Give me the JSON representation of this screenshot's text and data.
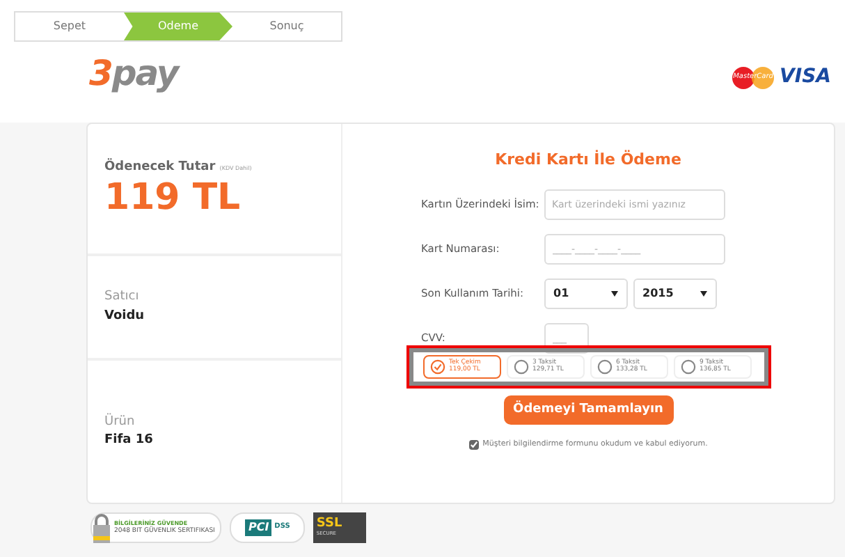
{
  "steps": [
    {
      "label": "Sepet",
      "selected": false
    },
    {
      "label": "Odeme",
      "selected": true
    },
    {
      "label": "Sonuç",
      "selected": false
    }
  ],
  "logo": {
    "digit": "3",
    "word": "pay"
  },
  "card_brands": {
    "mastercard": "MasterCard",
    "visa": "VISA"
  },
  "summary": {
    "amount_label": "Ödenecek Tutar",
    "amount_note": "(KDV Dahil)",
    "amount": "119 TL",
    "seller_label": "Satıcı",
    "seller": "Voidu",
    "product_label": "Ürün",
    "product": "Fifa 16"
  },
  "form": {
    "title": "Kredi Kartı İle Ödeme",
    "name_label": "Kartın Üzerindeki İsim:",
    "name_placeholder": "Kart üzerindeki ismi yazınız",
    "number_label": "Kart Numarası:",
    "number_placeholder": "____-____-____-____",
    "expiry_label": "Son Kullanım Tarihi:",
    "month": "01",
    "year": "2015",
    "cvv_label": "CVV:",
    "cvv_placeholder": "___",
    "installments": [
      {
        "label": "Tek Çekim",
        "amount": "119,00 TL",
        "selected": true
      },
      {
        "label": "3 Taksit",
        "amount": "129,71 TL",
        "selected": false
      },
      {
        "label": "6 Taksit",
        "amount": "133,28 TL",
        "selected": false
      },
      {
        "label": "9 Taksit",
        "amount": "136,85 TL",
        "selected": false
      }
    ],
    "submit": "Ödemeyi Tamamlayın",
    "agree_checked": true,
    "agree_text": "Müşteri bilgilendirme formunu okudum ve kabul ediyorum."
  },
  "badges": {
    "secure_title": "BİLGİLERİNİZ GÜVENDE",
    "secure_sub": "2048 BIT GÜVENLIK SERTIFIKASI",
    "pci": "PCI",
    "dss": "DSS",
    "ssl": "SSL",
    "ssl_sub": "SECURE"
  }
}
